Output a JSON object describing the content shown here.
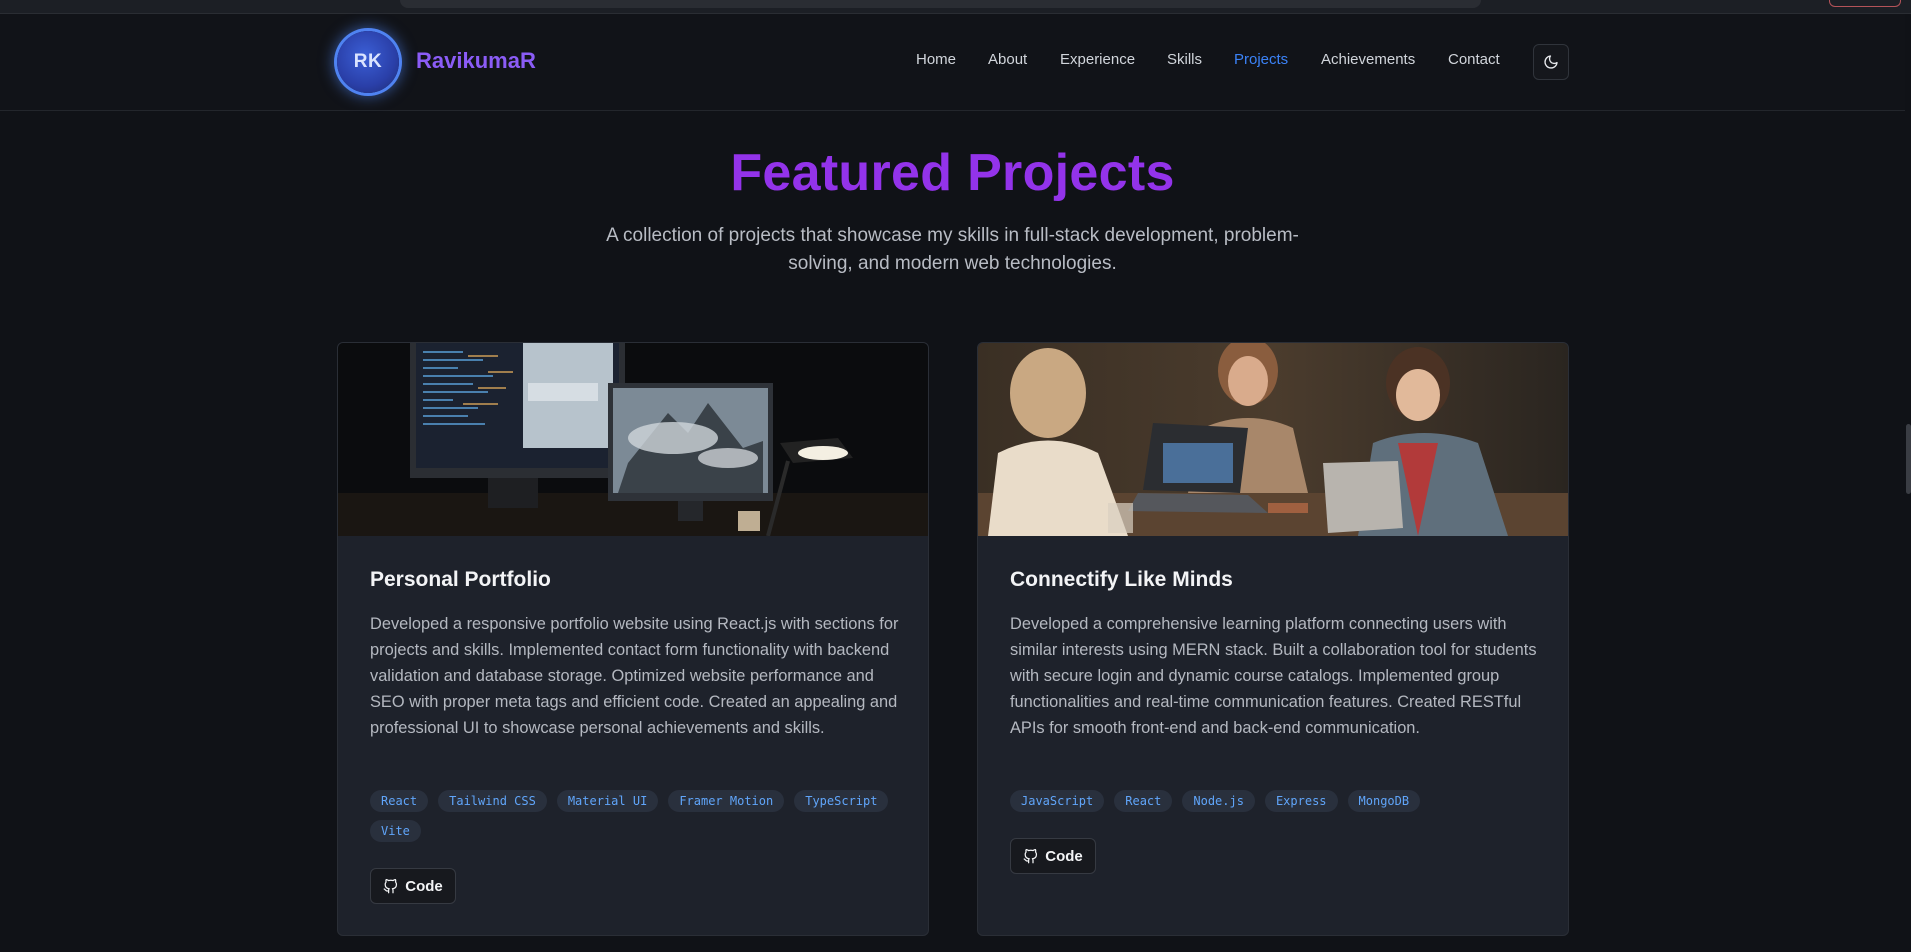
{
  "header": {
    "logo_initials": "RK",
    "brand": "RavikumaR",
    "nav": [
      "Home",
      "About",
      "Experience",
      "Skills",
      "Projects",
      "Achievements",
      "Contact"
    ],
    "active_nav": "Projects",
    "theme_toggle_icon": "moon-icon"
  },
  "section": {
    "title": "Featured Projects",
    "subtitle": "A collection of projects that showcase my skills in full-stack development, problem-solving, and modern web technologies."
  },
  "projects": [
    {
      "title": "Personal Portfolio",
      "description": "Developed a responsive portfolio website using React.js with sections for projects and skills. Implemented contact form functionality with backend validation and database storage. Optimized website performance and SEO with proper meta tags and efficient code. Created an appealing and professional UI to showcase personal achievements and skills.",
      "tags": [
        "React",
        "Tailwind CSS",
        "Material UI",
        "Framer Motion",
        "TypeScript",
        "Vite"
      ],
      "code_label": "Code",
      "code_icon": "github-icon"
    },
    {
      "title": "Connectify Like Minds",
      "description": "Developed a comprehensive learning platform connecting users with similar interests using MERN stack. Built a collaboration tool for students with secure login and dynamic course catalogs. Implemented group functionalities and real-time communication features. Created RESTful APIs for smooth front-end and back-end communication.",
      "tags": [
        "JavaScript",
        "React",
        "Node.js",
        "Express",
        "MongoDB"
      ],
      "code_label": "Code",
      "code_icon": "github-icon"
    }
  ],
  "colors": {
    "background": "#101217",
    "card": "#1e222b",
    "accent_purple": "#9333ea",
    "accent_blue": "#3b82f6",
    "tag_text": "#60a5fa"
  }
}
